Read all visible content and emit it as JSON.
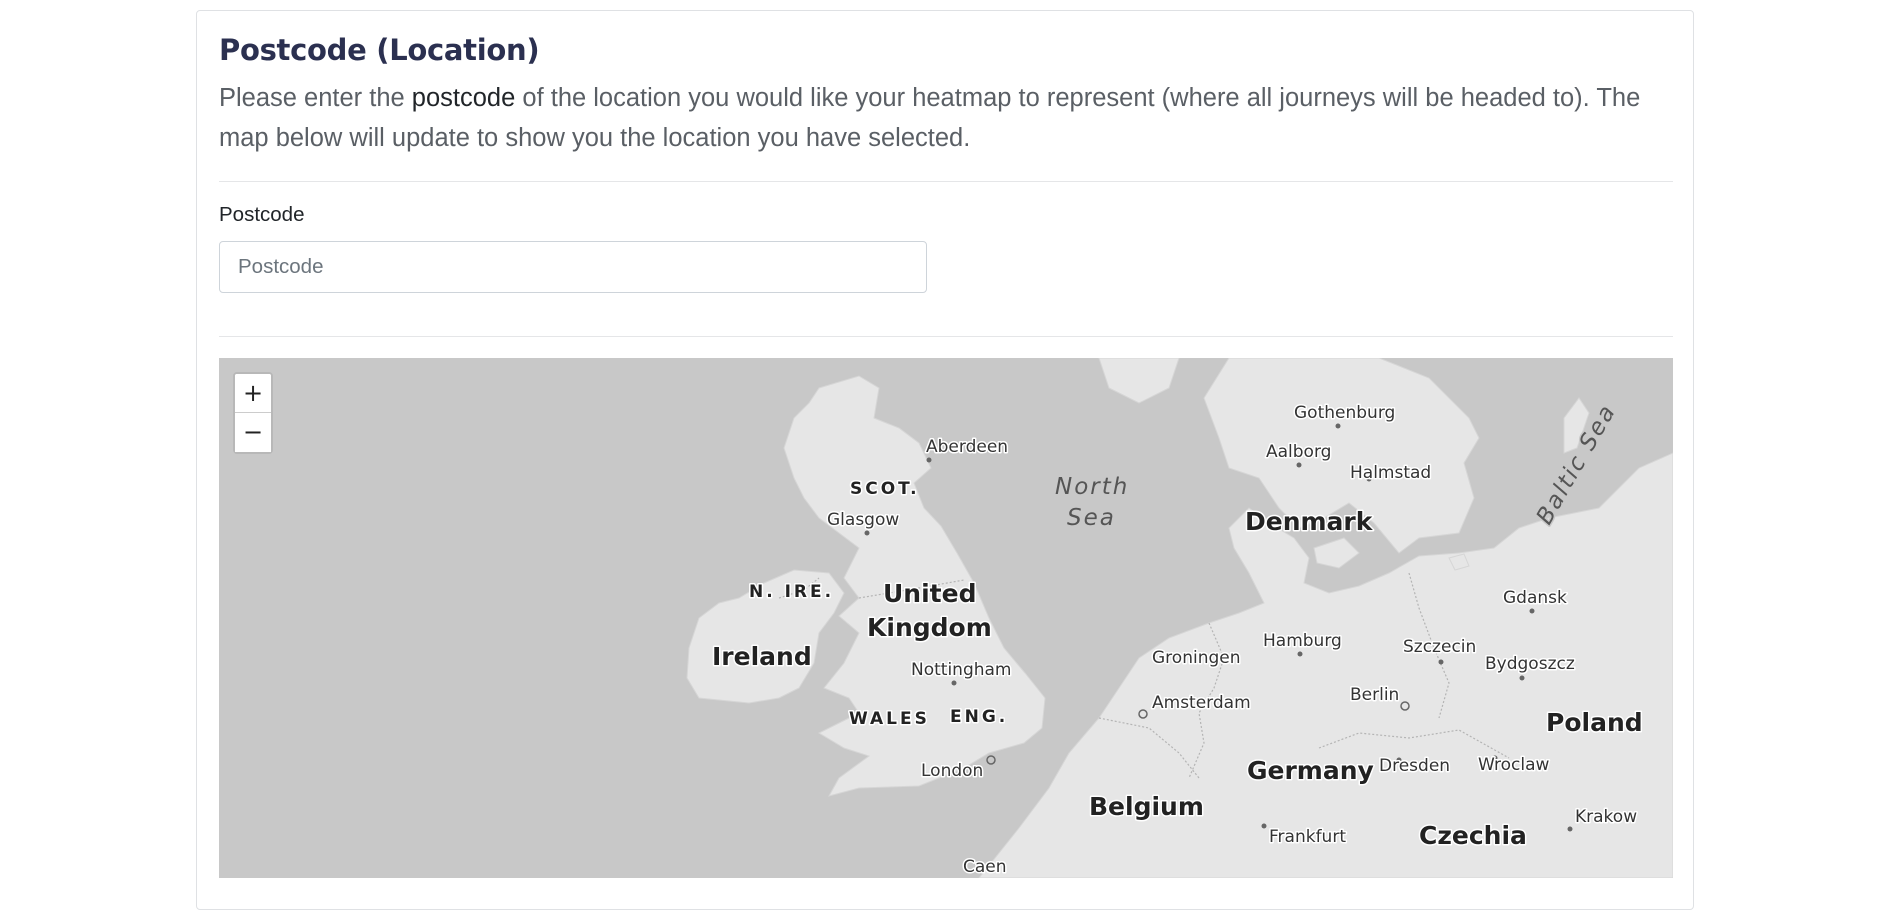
{
  "section": {
    "title": "Postcode (Location)",
    "description_pre": "Please enter the ",
    "description_em": "postcode",
    "description_post": " of the location you would like your heatmap to represent (where all journeys will be headed to). The map below will update to show you the location you have selected."
  },
  "form": {
    "postcode_label": "Postcode",
    "postcode_placeholder": "Postcode",
    "postcode_value": ""
  },
  "map": {
    "zoom_in": "+",
    "zoom_out": "−",
    "labels": {
      "aberdeen": "Aberdeen",
      "scot": "SCOT.",
      "glasgow": "Glasgow",
      "nire": "N. IRE.",
      "united": "United",
      "kingdom": "Kingdom",
      "ireland": "Ireland",
      "nottingham": "Nottingham",
      "wales": "WALES",
      "eng": "ENG.",
      "london": "London",
      "caen": "Caen",
      "north": "North",
      "sea": "Sea",
      "gothenburg": "Gothenburg",
      "aalborg": "Aalborg",
      "halmstad": "Halmstad",
      "denmark": "Denmark",
      "baltic_sea": "Baltic Sea",
      "gdansk": "Gdansk",
      "hamburg": "Hamburg",
      "szczecin": "Szczecin",
      "groningen": "Groningen",
      "bydgoszcz": "Bydgoszcz",
      "berlin": "Berlin",
      "amsterdam": "Amsterdam",
      "poland": "Poland",
      "germany": "Germany",
      "dresden": "Dresden",
      "wroclaw": "Wroclaw",
      "belgium": "Belgium",
      "frankfurt": "Frankfurt",
      "czechia": "Czechia",
      "krakow": "Krakow"
    }
  }
}
